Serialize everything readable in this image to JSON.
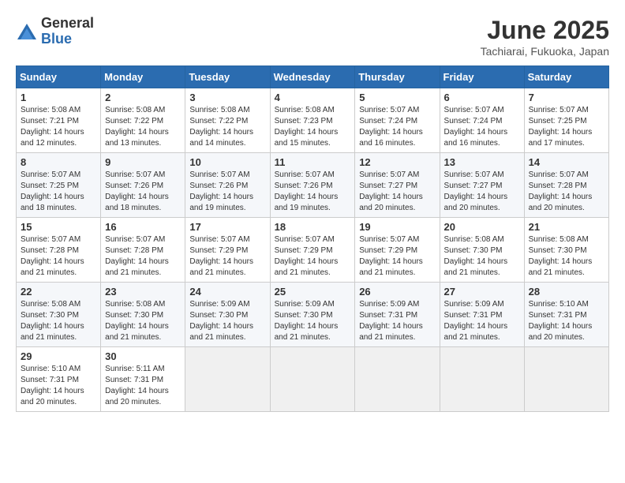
{
  "logo": {
    "general": "General",
    "blue": "Blue"
  },
  "header": {
    "title": "June 2025",
    "subtitle": "Tachiarai, Fukuoka, Japan"
  },
  "weekdays": [
    "Sunday",
    "Monday",
    "Tuesday",
    "Wednesday",
    "Thursday",
    "Friday",
    "Saturday"
  ],
  "weeks": [
    [
      {
        "day": "1",
        "sunrise": "5:08 AM",
        "sunset": "7:21 PM",
        "daylight": "14 hours and 12 minutes."
      },
      {
        "day": "2",
        "sunrise": "5:08 AM",
        "sunset": "7:22 PM",
        "daylight": "14 hours and 13 minutes."
      },
      {
        "day": "3",
        "sunrise": "5:08 AM",
        "sunset": "7:22 PM",
        "daylight": "14 hours and 14 minutes."
      },
      {
        "day": "4",
        "sunrise": "5:08 AM",
        "sunset": "7:23 PM",
        "daylight": "14 hours and 15 minutes."
      },
      {
        "day": "5",
        "sunrise": "5:07 AM",
        "sunset": "7:24 PM",
        "daylight": "14 hours and 16 minutes."
      },
      {
        "day": "6",
        "sunrise": "5:07 AM",
        "sunset": "7:24 PM",
        "daylight": "14 hours and 16 minutes."
      },
      {
        "day": "7",
        "sunrise": "5:07 AM",
        "sunset": "7:25 PM",
        "daylight": "14 hours and 17 minutes."
      }
    ],
    [
      {
        "day": "8",
        "sunrise": "5:07 AM",
        "sunset": "7:25 PM",
        "daylight": "14 hours and 18 minutes."
      },
      {
        "day": "9",
        "sunrise": "5:07 AM",
        "sunset": "7:26 PM",
        "daylight": "14 hours and 18 minutes."
      },
      {
        "day": "10",
        "sunrise": "5:07 AM",
        "sunset": "7:26 PM",
        "daylight": "14 hours and 19 minutes."
      },
      {
        "day": "11",
        "sunrise": "5:07 AM",
        "sunset": "7:26 PM",
        "daylight": "14 hours and 19 minutes."
      },
      {
        "day": "12",
        "sunrise": "5:07 AM",
        "sunset": "7:27 PM",
        "daylight": "14 hours and 20 minutes."
      },
      {
        "day": "13",
        "sunrise": "5:07 AM",
        "sunset": "7:27 PM",
        "daylight": "14 hours and 20 minutes."
      },
      {
        "day": "14",
        "sunrise": "5:07 AM",
        "sunset": "7:28 PM",
        "daylight": "14 hours and 20 minutes."
      }
    ],
    [
      {
        "day": "15",
        "sunrise": "5:07 AM",
        "sunset": "7:28 PM",
        "daylight": "14 hours and 21 minutes."
      },
      {
        "day": "16",
        "sunrise": "5:07 AM",
        "sunset": "7:28 PM",
        "daylight": "14 hours and 21 minutes."
      },
      {
        "day": "17",
        "sunrise": "5:07 AM",
        "sunset": "7:29 PM",
        "daylight": "14 hours and 21 minutes."
      },
      {
        "day": "18",
        "sunrise": "5:07 AM",
        "sunset": "7:29 PM",
        "daylight": "14 hours and 21 minutes."
      },
      {
        "day": "19",
        "sunrise": "5:07 AM",
        "sunset": "7:29 PM",
        "daylight": "14 hours and 21 minutes."
      },
      {
        "day": "20",
        "sunrise": "5:08 AM",
        "sunset": "7:30 PM",
        "daylight": "14 hours and 21 minutes."
      },
      {
        "day": "21",
        "sunrise": "5:08 AM",
        "sunset": "7:30 PM",
        "daylight": "14 hours and 21 minutes."
      }
    ],
    [
      {
        "day": "22",
        "sunrise": "5:08 AM",
        "sunset": "7:30 PM",
        "daylight": "14 hours and 21 minutes."
      },
      {
        "day": "23",
        "sunrise": "5:08 AM",
        "sunset": "7:30 PM",
        "daylight": "14 hours and 21 minutes."
      },
      {
        "day": "24",
        "sunrise": "5:09 AM",
        "sunset": "7:30 PM",
        "daylight": "14 hours and 21 minutes."
      },
      {
        "day": "25",
        "sunrise": "5:09 AM",
        "sunset": "7:30 PM",
        "daylight": "14 hours and 21 minutes."
      },
      {
        "day": "26",
        "sunrise": "5:09 AM",
        "sunset": "7:31 PM",
        "daylight": "14 hours and 21 minutes."
      },
      {
        "day": "27",
        "sunrise": "5:09 AM",
        "sunset": "7:31 PM",
        "daylight": "14 hours and 21 minutes."
      },
      {
        "day": "28",
        "sunrise": "5:10 AM",
        "sunset": "7:31 PM",
        "daylight": "14 hours and 20 minutes."
      }
    ],
    [
      {
        "day": "29",
        "sunrise": "5:10 AM",
        "sunset": "7:31 PM",
        "daylight": "14 hours and 20 minutes."
      },
      {
        "day": "30",
        "sunrise": "5:11 AM",
        "sunset": "7:31 PM",
        "daylight": "14 hours and 20 minutes."
      },
      null,
      null,
      null,
      null,
      null
    ]
  ],
  "labels": {
    "sunrise": "Sunrise:",
    "sunset": "Sunset:",
    "daylight": "Daylight hours"
  }
}
